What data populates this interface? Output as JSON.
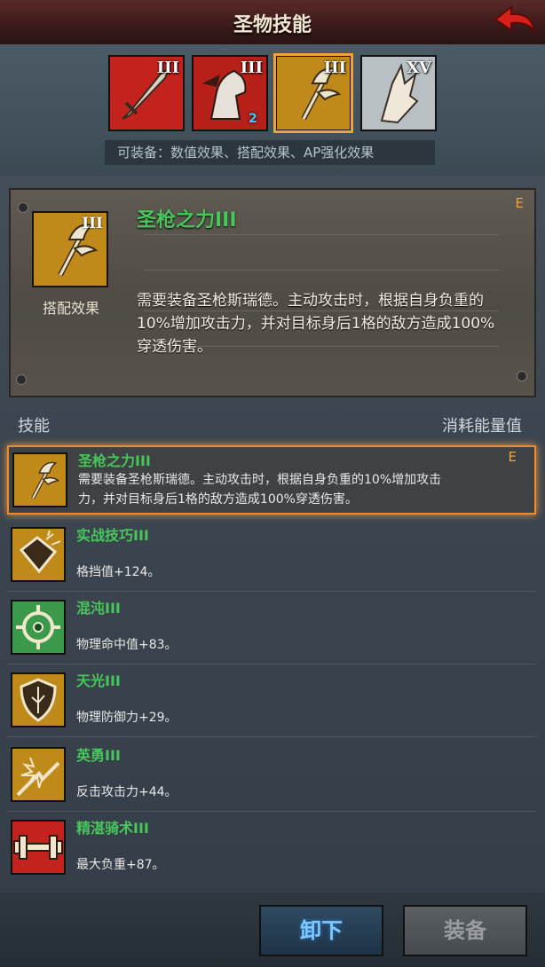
{
  "header": {
    "title": "圣物技能",
    "back_icon": "back-arrow-icon"
  },
  "relics": [
    {
      "num": "III",
      "icon": "sword-icon",
      "bg": "#c4221c"
    },
    {
      "num": "III",
      "icon": "horse-icon",
      "bg": "#b62018",
      "badge": "2"
    },
    {
      "num": "III",
      "icon": "trident-icon",
      "bg": "#c08a1a",
      "selected": true
    },
    {
      "num": "XV",
      "icon": "claw-icon",
      "bg": "#b8c0c4"
    }
  ],
  "equip_types": "可装备：数值效果、搭配效果、AP强化效果",
  "detail": {
    "num": "III",
    "caption": "搭配效果",
    "name": "圣枪之力III",
    "grade": "E",
    "desc": "需要装备圣枪斯瑞德。主动攻击时，根据自身负重的10%增加攻击力，并对目标身后1格的敌方造成100%穿透伤害。"
  },
  "list_headers": {
    "left": "技能",
    "right": "消耗能量值"
  },
  "skills": [
    {
      "name": "圣枪之力III",
      "grade": "E",
      "desc": "需要装备圣枪斯瑞德。主动攻击时，根据自身负重的10%增加攻击力，并对目标身后1格的敌方造成100%穿透伤害。",
      "icon": "trident-icon",
      "bg": "#c08a1a"
    },
    {
      "name": "实战技巧III",
      "desc": "格挡值+124。",
      "icon": "shield-break-icon",
      "bg": "#c08a1a"
    },
    {
      "name": "混沌III",
      "desc": "物理命中值+83。",
      "icon": "crosshair-icon",
      "bg": "#3a9a4a"
    },
    {
      "name": "天光III",
      "desc": "物理防御力+29。",
      "icon": "shield-icon",
      "bg": "#c08a1a"
    },
    {
      "name": "英勇III",
      "desc": "反击攻击力+44。",
      "icon": "burst-icon",
      "bg": "#c08a1a"
    },
    {
      "name": "精湛骑术III",
      "desc": "最大负重+87。",
      "icon": "dumbbell-icon",
      "bg": "#c4221c"
    }
  ],
  "buttons": {
    "unequip": "卸下",
    "equip": "装备"
  }
}
